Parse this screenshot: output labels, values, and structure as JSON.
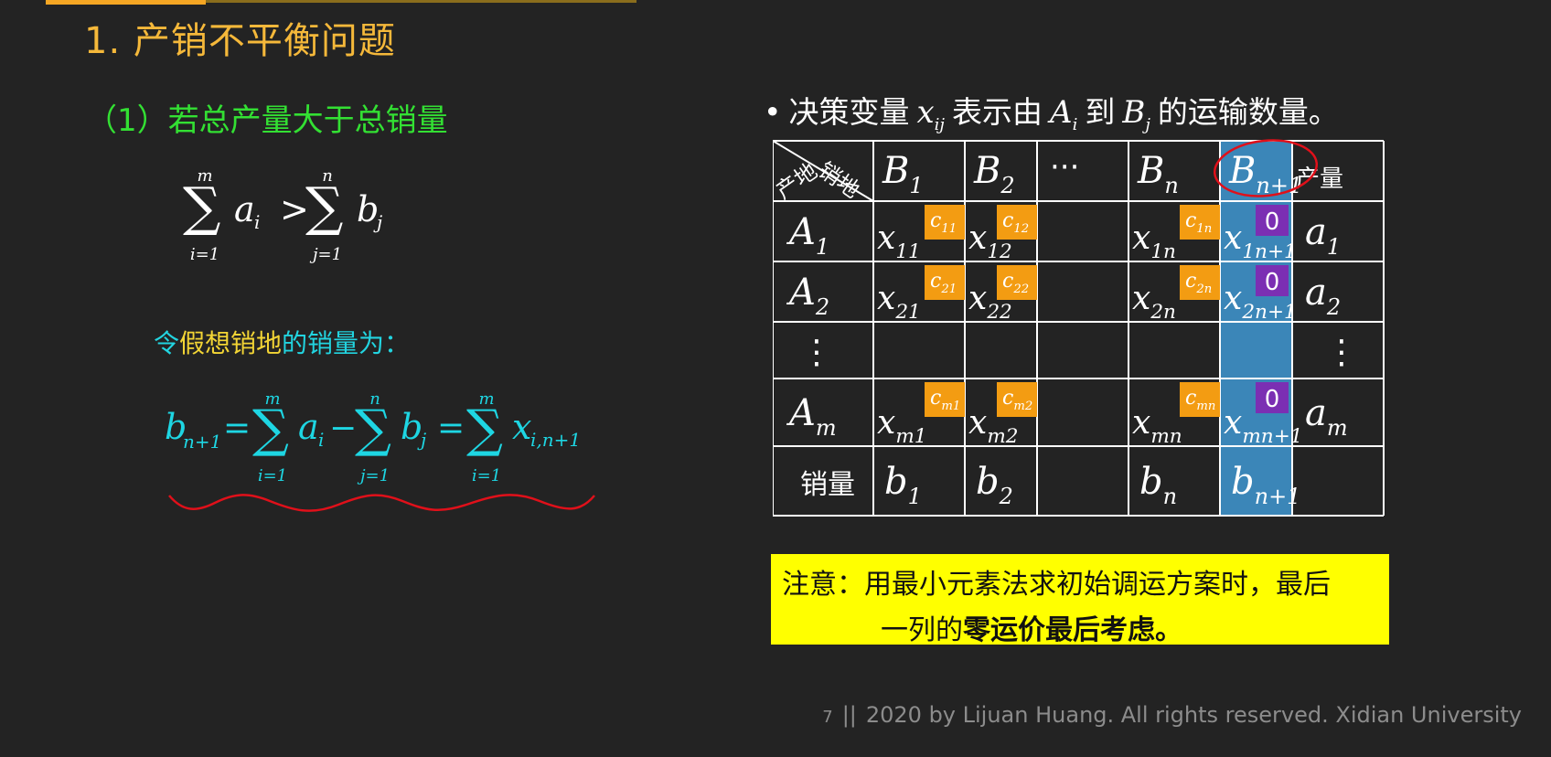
{
  "title": "1. 产销不平衡问题",
  "subtitle": "（1）若总产量大于总销量",
  "let_line": {
    "part1": "令",
    "part2": "假想销地",
    "part3": "的销量为："
  },
  "bullet": {
    "pre": "决策变量",
    "var": "x",
    "var_sub": "ij",
    "mid1": "表示由",
    "a": "A",
    "a_sub": "i",
    "mid2": "到",
    "b": "B",
    "b_sub": "j",
    "post": "的运输数量。"
  },
  "table": {
    "corner_top": "销地",
    "corner_bottom": "产地",
    "col_headers": [
      "B1",
      "B2",
      "···",
      "Bn",
      "Bn+1"
    ],
    "last_col_header": "产量",
    "rows": [
      {
        "label": "A1",
        "cells": [
          "x11",
          "x12",
          "",
          "x1n",
          "x1n+1"
        ],
        "costs": [
          "c11",
          "c12",
          "",
          "c1n",
          "0"
        ],
        "supply": "a1"
      },
      {
        "label": "A2",
        "cells": [
          "x21",
          "x22",
          "",
          "x2n",
          "x2n+1"
        ],
        "costs": [
          "c21",
          "c22",
          "",
          "c2n",
          "0"
        ],
        "supply": "a2"
      },
      {
        "label": "⋮",
        "cells": [
          "",
          "",
          "",
          "",
          ""
        ],
        "costs": [
          "",
          "",
          "",
          "",
          ""
        ],
        "supply": "⋮"
      },
      {
        "label": "Am",
        "cells": [
          "xm1",
          "xm2",
          "",
          "xmn",
          "xmn+1"
        ],
        "costs": [
          "cm1",
          "cm2",
          "",
          "cmn",
          "0"
        ],
        "supply": "am"
      }
    ],
    "demand_label": "销量",
    "demand": [
      "b1",
      "b2",
      "",
      "bn",
      "bn+1"
    ]
  },
  "note": {
    "label": "注意：",
    "line1": "用最小元素法求初始调运方案时，最后",
    "line2_prefix": "一列的",
    "line2_bold": "零运价最后考虑。"
  },
  "footer": {
    "page": "7",
    "sep": "||",
    "text": "2020 by Lijuan Huang.  All rights reserved.  Xidian University"
  },
  "colors": {
    "title": "#f5b83a",
    "subtitle": "#33e033",
    "cyan": "#22d4e0",
    "yellow_text": "#f3d535",
    "cost_box": "#f39c12",
    "zero_box": "#7b2fb3",
    "highlight_col": "#3b86b8",
    "note_bg": "#ffff00",
    "red_mark": "#e0101a"
  }
}
